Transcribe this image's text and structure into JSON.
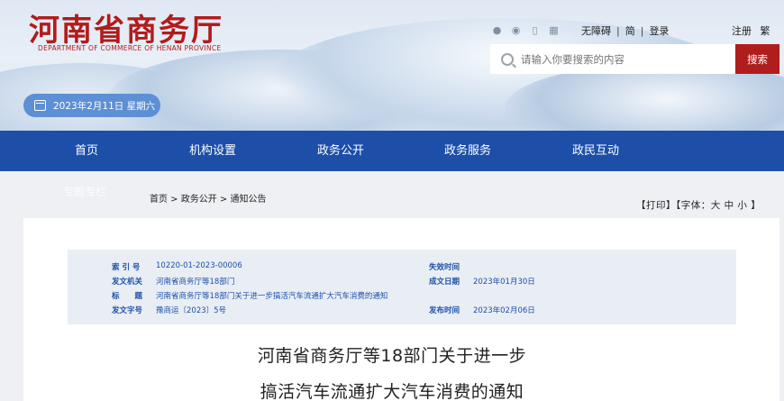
{
  "header": {
    "logo_title": "河南省商务厅",
    "logo_subtitle": "DEPARTMENT OF COMMERCE OF HENAN PROVINCE",
    "top_links": {
      "icons": [
        "wechat-icon",
        "weibo-icon",
        "mobile-icon",
        "app-icon"
      ],
      "accessibility": "无障碍",
      "simplified": "简",
      "login": "登录",
      "register": "注册",
      "traditional": "繁"
    },
    "search": {
      "placeholder": "请输入你要搜索的内容",
      "button_label": "搜索"
    },
    "date_text": "2023年2月11日 星期六"
  },
  "nav": {
    "items": [
      "首页",
      "机构设置",
      "政务公开",
      "政务服务",
      "政民互动"
    ],
    "background": "#1d4fa8"
  },
  "content": {
    "ghost_text": "专题专栏",
    "breadcrumb": "首页 > 政务公开 > 通知公告",
    "tools": "【打印】【字体：大 中 小 】",
    "meta": {
      "index_label": "索 引 号",
      "index_value": "10220-01-2023-00006",
      "issuer_label": "发文机关",
      "issuer_value": "河南省商务厅等18部门",
      "title_label": "标　　题",
      "title_value": "河南省商务厅等18部门关于进一步搞活汽车流通扩大汽车消费的通知",
      "docno_label": "发文字号",
      "docno_value": "豫商运〔2023〕5号",
      "expiry_label": "失效时间",
      "expiry_value": "",
      "written_label": "成文日期",
      "written_value": "2023年01月30日",
      "published_label": "发布时间",
      "published_value": "2023年02月06日"
    },
    "article_title_line1": "河南省商务厅等18部门关于进一步",
    "article_title_line2": "搞活汽车流通扩大汽车消费的通知"
  },
  "colors": {
    "brand_red": "#b21b1b",
    "nav_blue": "#1d4fa8",
    "date_pill_blue": "#5d8fd4"
  }
}
